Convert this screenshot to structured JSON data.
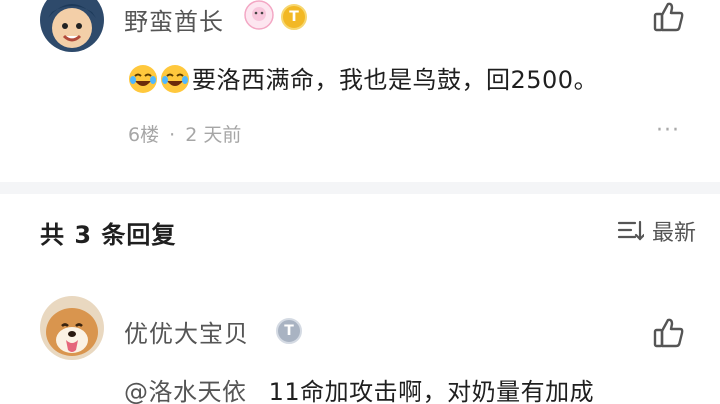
{
  "comment_top": {
    "username": "野蛮酋长",
    "level_badge": "T",
    "text": "要洛西满命，我也是鸟鼓，回2500。",
    "emoji": [
      "laugh-cry-emoji",
      "laugh-cry-emoji"
    ],
    "floor": "6楼",
    "separator": "·",
    "time": "2 天前",
    "more": "···"
  },
  "replies_header": {
    "title": "共 3 条回复",
    "sort_label": "最新"
  },
  "reply_1": {
    "username": "优优大宝贝",
    "level_badge": "T",
    "mention": "@洛水天依",
    "text": "11命加攻击啊，对奶量有加成"
  },
  "colors": {
    "accent_gold": "#f2b825",
    "badge_gray": "#a9b3c2",
    "band": "#f4f5f7"
  }
}
